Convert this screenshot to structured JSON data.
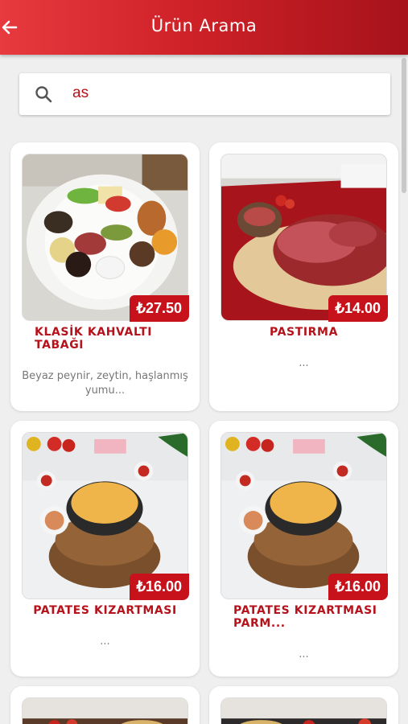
{
  "header": {
    "title": "Ürün Arama",
    "back_icon": "arrow-left-icon",
    "background_colors": [
      "#e63a3f",
      "#a7121b"
    ]
  },
  "search": {
    "value": "as",
    "icon": "search-icon"
  },
  "accent_color": "#c8121b",
  "products": [
    {
      "name": "KLASİK KAHVALTI TABAĞI",
      "price": "₺27.50",
      "description": "Beyaz peynir, zeytin, haşlanmış yumu..."
    },
    {
      "name": "PASTIRMA",
      "price": "₺14.00",
      "description": "..."
    },
    {
      "name": "PATATES KIZARTMASI",
      "price": "₺16.00",
      "description": "..."
    },
    {
      "name": "PATATES KIZARTMASI PARM...",
      "price": "₺16.00",
      "description": "..."
    }
  ]
}
